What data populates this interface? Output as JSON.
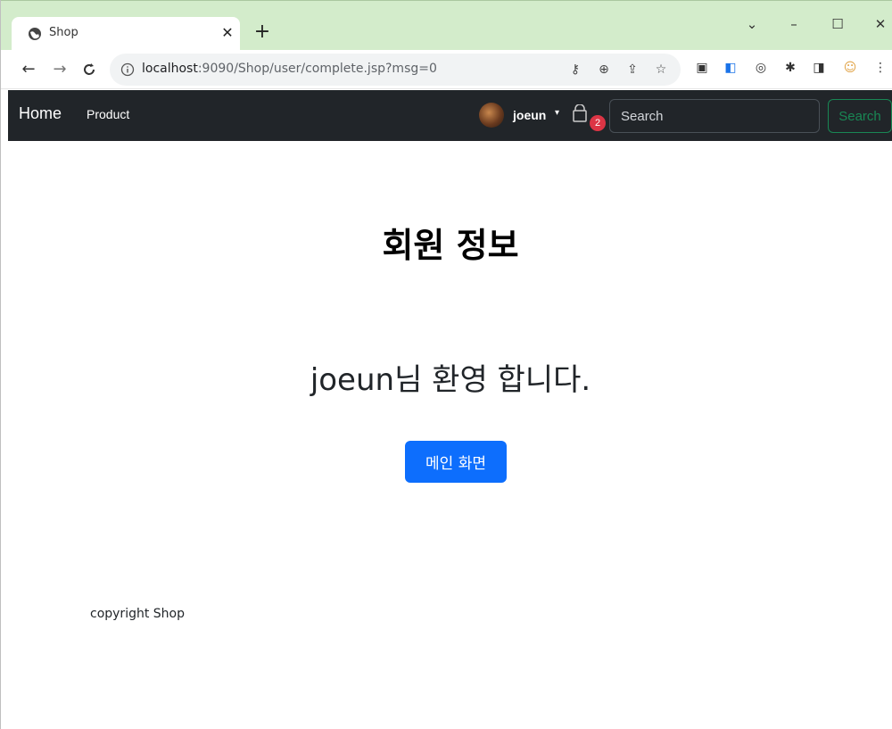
{
  "browser": {
    "tab_title": "Shop",
    "tab_close": "✕",
    "new_tab": "+",
    "url_host": "localhost",
    "url_path": ":9090/Shop/user/complete.jsp?msg=0",
    "window_controls": {
      "chevron": "⌄",
      "minimize": "–",
      "maximize": "☐",
      "close": "✕"
    }
  },
  "navbar": {
    "brand": "Home",
    "items": [
      "Product"
    ],
    "user_name": "joeun",
    "cart_count": "2",
    "search_placeholder": "Search",
    "search_button": "Search",
    "colors": {
      "bg": "#212529",
      "badge": "#dc3545",
      "search_btn": "#198754"
    }
  },
  "main": {
    "title": "회원 정보",
    "welcome_user": "joeun",
    "welcome_suffix": "님 환영 합니다.",
    "main_button": "메인 화면",
    "colors": {
      "primary": "#0d6efd"
    }
  },
  "footer": {
    "text": "copyright Shop"
  }
}
